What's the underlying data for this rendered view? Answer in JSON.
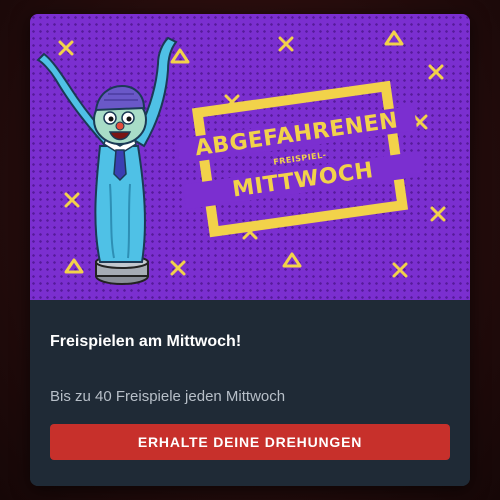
{
  "banner": {
    "promo_line_1": "ABGEFAHRENEN",
    "promo_line_2": "FREISPIEL-",
    "promo_line_3": "MITTWOCH",
    "illustration": "inflatable-tube-man-icon"
  },
  "promo": {
    "title": "Freispielen am Mittwoch!",
    "subtitle": "Bis zu 40 Freispiele jeden Mittwoch",
    "cta_label": "ERHALTE DEINE DREHUNGEN"
  },
  "colors": {
    "banner_purple": "#7b2fd0",
    "accent_yellow": "#f2d24a",
    "card_background": "#1f2a36",
    "cta_red": "#c7302b"
  }
}
